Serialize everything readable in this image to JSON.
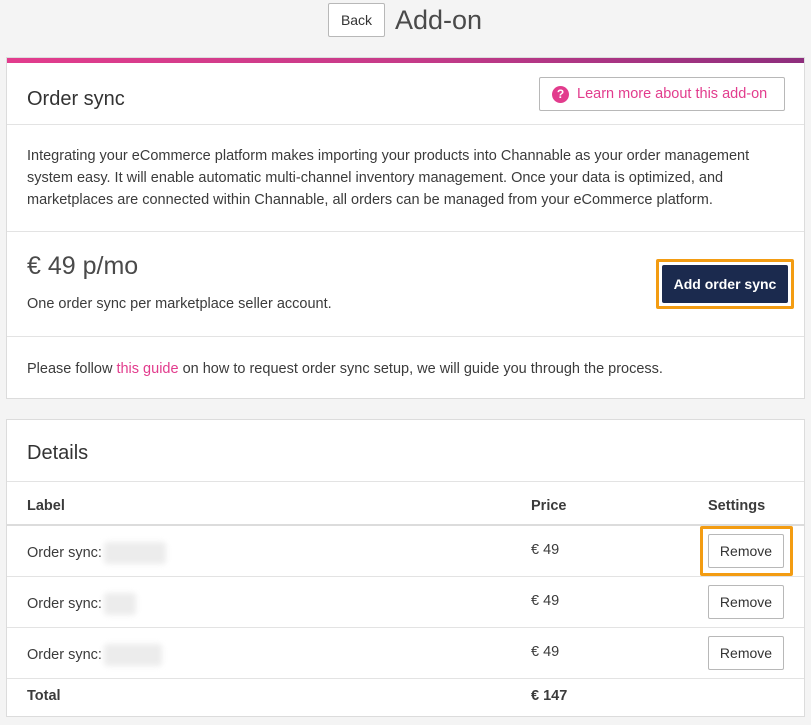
{
  "header": {
    "back_label": "Back",
    "title": "Add-on"
  },
  "addon": {
    "name": "Order sync",
    "learn_more_label": "Learn more about this add-on",
    "description": "Integrating your eCommerce platform makes importing your products into Channable as your order management system easy. It will enable automatic multi-channel inventory management. Once your data is optimized, and marketplaces are connected within Channable, all orders can be managed from your eCommerce platform.",
    "price": "€ 49 p/mo",
    "price_note": "One order sync per marketplace seller account.",
    "add_button_label": "Add order sync",
    "guide_prefix": "Please follow ",
    "guide_link": "this guide",
    "guide_suffix": " on how to request order sync setup, we will guide you through the process."
  },
  "details": {
    "title": "Details",
    "columns": [
      "Label",
      "Price",
      "Settings"
    ],
    "rows": [
      {
        "label": "Order sync:",
        "price": "€ 49",
        "action": "Remove"
      },
      {
        "label": "Order sync:",
        "price": "€ 49",
        "action": "Remove"
      },
      {
        "label": "Order sync:",
        "price": "€ 49",
        "action": "Remove"
      }
    ],
    "total_label": "Total",
    "total_value": "€ 147"
  },
  "colors": {
    "accent": "#e23c8d",
    "primary_button": "#1b2a4e",
    "highlight": "#f39c12"
  },
  "icons": {
    "learn_more": "question-circle-icon"
  }
}
